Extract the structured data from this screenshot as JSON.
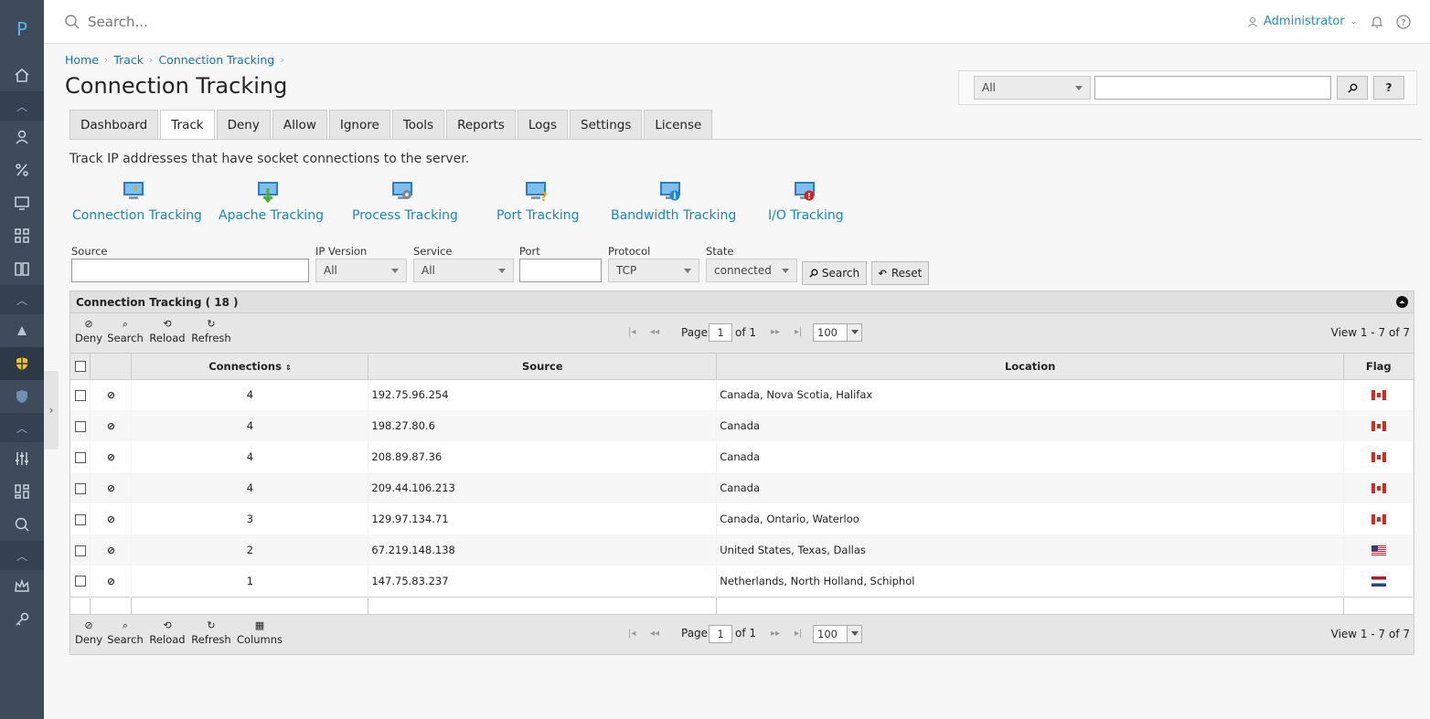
{
  "app": {
    "logo": "P"
  },
  "topbar": {
    "search_placeholder": "Search...",
    "user": "Administrator"
  },
  "breadcrumb": [
    "Home",
    "Track",
    "Connection Tracking"
  ],
  "page_title": "Connection Tracking",
  "quick_search": {
    "scope": "All",
    "value": "",
    "help": "?"
  },
  "tabs": [
    "Dashboard",
    "Track",
    "Deny",
    "Allow",
    "Ignore",
    "Tools",
    "Reports",
    "Logs",
    "Settings",
    "License"
  ],
  "active_tab": "Track",
  "description": "Track IP addresses that have socket connections to the server.",
  "tracking_links": [
    {
      "label": "Connection Tracking",
      "icon": "connection-tracking-icon"
    },
    {
      "label": "Apache Tracking",
      "icon": "apache-tracking-icon"
    },
    {
      "label": "Process Tracking",
      "icon": "process-tracking-icon"
    },
    {
      "label": "Port Tracking",
      "icon": "port-tracking-icon"
    },
    {
      "label": "Bandwidth Tracking",
      "icon": "bandwidth-tracking-icon"
    },
    {
      "label": "I/O Tracking",
      "icon": "io-tracking-icon"
    }
  ],
  "filters": {
    "source_label": "Source",
    "source_value": "",
    "ip_version_label": "IP Version",
    "ip_version_value": "All",
    "service_label": "Service",
    "service_value": "All",
    "port_label": "Port",
    "port_value": "",
    "protocol_label": "Protocol",
    "protocol_value": "TCP",
    "state_label": "State",
    "state_value": "connected",
    "search_btn": "Search",
    "reset_btn": "Reset"
  },
  "grid": {
    "caption": "Connection Tracking ( 18 )",
    "toolbar_top": [
      "Deny",
      "Search",
      "Reload",
      "Refresh"
    ],
    "toolbar_bottom": [
      "Deny",
      "Search",
      "Reload",
      "Refresh",
      "Columns"
    ],
    "page_label": "Page",
    "page_value": "1",
    "of_label": "of 1",
    "rows_per_page": "100",
    "view_info": "View 1 - 7 of 7",
    "columns": [
      "Connections",
      "Source",
      "Location",
      "Flag"
    ],
    "rows": [
      {
        "connections": "4",
        "source": "192.75.96.254",
        "location": "Canada, Nova Scotia, Halifax",
        "flag": "ca"
      },
      {
        "connections": "4",
        "source": "198.27.80.6",
        "location": "Canada",
        "flag": "ca"
      },
      {
        "connections": "4",
        "source": "208.89.87.36",
        "location": "Canada",
        "flag": "ca"
      },
      {
        "connections": "4",
        "source": "209.44.106.213",
        "location": "Canada",
        "flag": "ca"
      },
      {
        "connections": "3",
        "source": "129.97.134.71",
        "location": "Canada, Ontario, Waterloo",
        "flag": "ca"
      },
      {
        "connections": "2",
        "source": "67.219.148.138",
        "location": "United States, Texas, Dallas",
        "flag": "us"
      },
      {
        "connections": "1",
        "source": "147.75.83.237",
        "location": "Netherlands, North Holland, Schiphol",
        "flag": "nl"
      }
    ]
  }
}
